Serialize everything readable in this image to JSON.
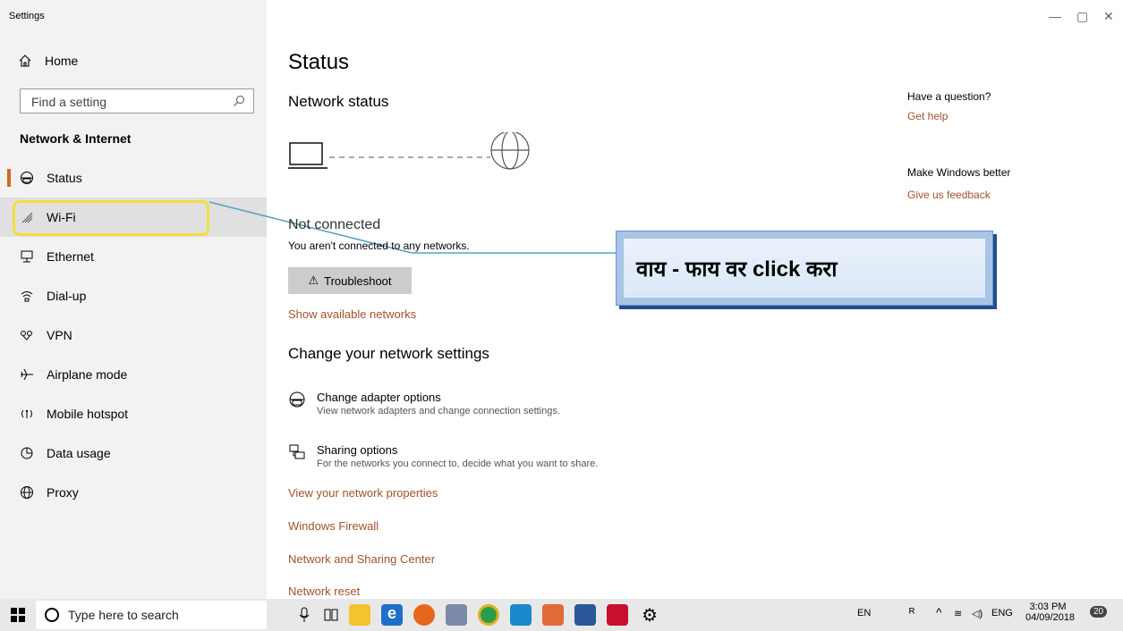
{
  "app": {
    "title": "Settings",
    "window_controls": [
      "—",
      "▢",
      "✕"
    ]
  },
  "sidebar": {
    "home_label": "Home",
    "search_placeholder": "Find a setting",
    "section_title": "Network & Internet",
    "items": [
      {
        "label": "Status",
        "icon": "network-status-icon"
      },
      {
        "label": "Wi-Fi",
        "icon": "wifi-icon"
      },
      {
        "label": "Ethernet",
        "icon": "ethernet-icon"
      },
      {
        "label": "Dial-up",
        "icon": "dialup-icon"
      },
      {
        "label": "VPN",
        "icon": "vpn-icon"
      },
      {
        "label": "Airplane mode",
        "icon": "airplane-icon"
      },
      {
        "label": "Mobile hotspot",
        "icon": "hotspot-icon"
      },
      {
        "label": "Data usage",
        "icon": "data-usage-icon"
      },
      {
        "label": "Proxy",
        "icon": "globe-icon"
      }
    ]
  },
  "main": {
    "title": "Status",
    "network_status": "Network status",
    "not_connected": "Not connected",
    "not_connected_desc": "You aren't connected to any networks.",
    "troubleshoot": "Troubleshoot",
    "show_networks": "Show available networks",
    "change_title": "Change your network settings",
    "options": [
      {
        "title": "Change adapter options",
        "desc": "View network adapters and change connection settings."
      },
      {
        "title": "Sharing options",
        "desc": "For the networks you connect to, decide what you want to share."
      }
    ],
    "links": [
      "View your network properties",
      "Windows Firewall",
      "Network and Sharing Center",
      "Network reset"
    ]
  },
  "aside": {
    "question": "Have a question?",
    "get_help": "Get help",
    "make_better": "Make Windows better",
    "feedback": "Give us feedback"
  },
  "callout": {
    "text": "वाय - फाय वर click करा"
  },
  "taskbar": {
    "search_placeholder": "Type here to search",
    "lang": "EN",
    "lang2": "ENG",
    "time": "3:03 PM",
    "date": "04/09/2018",
    "notifications": "20"
  },
  "colors": {
    "accent": "#d2691e",
    "link": "#a0522d",
    "highlight": "#f0e040",
    "callout": "#a8c4e6"
  }
}
